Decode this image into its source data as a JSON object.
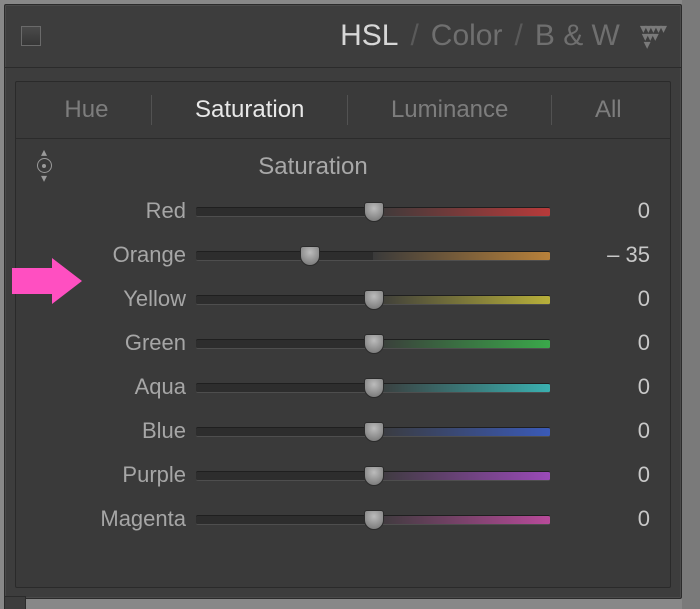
{
  "header": {
    "items": [
      {
        "label": "HSL",
        "active": true
      },
      {
        "label": "Color",
        "active": false
      },
      {
        "label": "B & W",
        "active": false
      }
    ]
  },
  "tabs": [
    {
      "label": "Hue",
      "active": false
    },
    {
      "label": "Saturation",
      "active": true
    },
    {
      "label": "Luminance",
      "active": false
    },
    {
      "label": "All",
      "active": false
    }
  ],
  "section_title": "Saturation",
  "sliders": [
    {
      "label": "Red",
      "value": 0,
      "display": "0",
      "knob_pct": 50,
      "grad": "linear-gradient(to right,#3a3a3a,#b83a3a)"
    },
    {
      "label": "Orange",
      "value": -35,
      "display": "– 35",
      "knob_pct": 32,
      "grad": "linear-gradient(to right,#3a3a3a,#b8813a)"
    },
    {
      "label": "Yellow",
      "value": 0,
      "display": "0",
      "knob_pct": 50,
      "grad": "linear-gradient(to right,#3a3a3a,#b8b03a)"
    },
    {
      "label": "Green",
      "value": 0,
      "display": "0",
      "knob_pct": 50,
      "grad": "linear-gradient(to right,#3a3a3a,#3aa84a)"
    },
    {
      "label": "Aqua",
      "value": 0,
      "display": "0",
      "knob_pct": 50,
      "grad": "linear-gradient(to right,#3a3a3a,#3ab0b0)"
    },
    {
      "label": "Blue",
      "value": 0,
      "display": "0",
      "knob_pct": 50,
      "grad": "linear-gradient(to right,#3a3a3a,#3a5ab8)"
    },
    {
      "label": "Purple",
      "value": 0,
      "display": "0",
      "knob_pct": 50,
      "grad": "linear-gradient(to right,#3a3a3a,#9a4ab8)"
    },
    {
      "label": "Magenta",
      "value": 0,
      "display": "0",
      "knob_pct": 50,
      "grad": "linear-gradient(to right,#3a3a3a,#b84a9a)"
    }
  ],
  "annotation": {
    "arrow_color": "#ff4fc1"
  }
}
